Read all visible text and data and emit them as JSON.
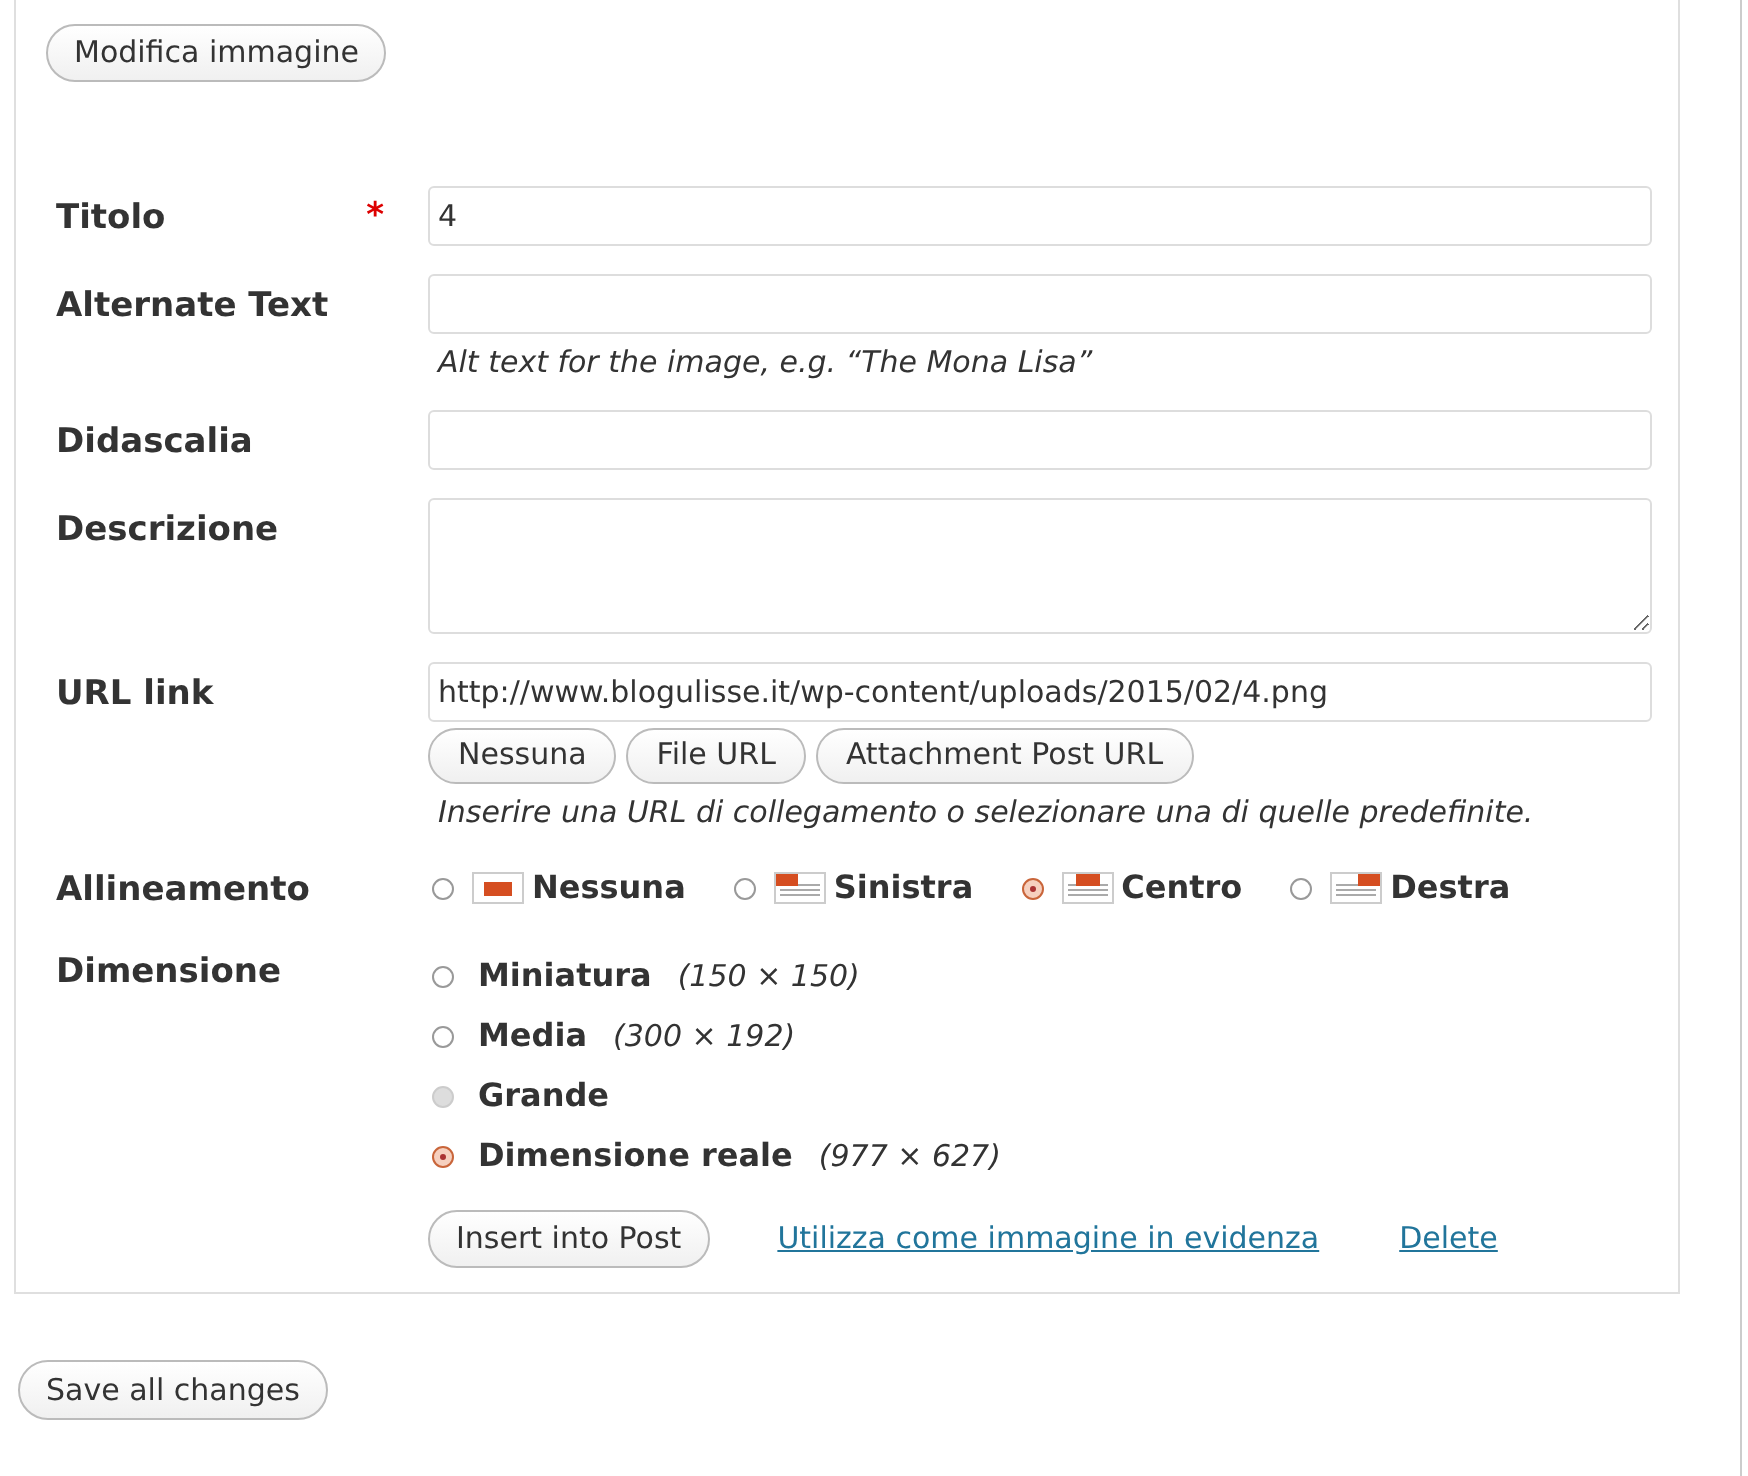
{
  "edit_image_button": "Modifica immagine",
  "fields": [
    {
      "label": "Titolo",
      "required_marker": "*",
      "kind": "input",
      "value": "4"
    },
    {
      "label": "Alternate Text",
      "kind": "input",
      "help": "Alt text for the image, e.g. “The Mona Lisa”"
    },
    {
      "label": "Didascalia",
      "kind": "input"
    },
    {
      "label": "Descrizione",
      "kind": "textarea"
    },
    {
      "label": "URL link",
      "kind": "url",
      "value": "http://www.blogulisse.it/wp-content/uploads/2015/02/4.png",
      "buttons": [
        "Nessuna",
        "File URL",
        "Attachment Post URL"
      ],
      "help": "Inserire una URL di collegamento o selezionare una di quelle predefinite."
    }
  ],
  "alignment": {
    "label": "Allineamento",
    "options": [
      {
        "label": "Nessuna",
        "kind": "none",
        "selected": false
      },
      {
        "label": "Sinistra",
        "kind": "left",
        "selected": false
      },
      {
        "label": "Centro",
        "kind": "center",
        "selected": true
      },
      {
        "label": "Destra",
        "kind": "right",
        "selected": false
      }
    ]
  },
  "size": {
    "label": "Dimensione",
    "options": [
      {
        "label": "Miniatura",
        "dims": "(150 × 150)",
        "selected": false,
        "disabled": false
      },
      {
        "label": "Media",
        "dims": "(300 × 192)",
        "selected": false,
        "disabled": false
      },
      {
        "label": "Grande",
        "selected": false,
        "disabled": true
      },
      {
        "label": "Dimensione reale",
        "dims": "(977 × 627)",
        "selected": true,
        "disabled": false
      }
    ]
  },
  "actions": {
    "insert_button": "Insert into Post",
    "featured_link": "Utilizza come immagine in evidenza",
    "delete_link": "Delete"
  },
  "save_button": "Save all changes"
}
